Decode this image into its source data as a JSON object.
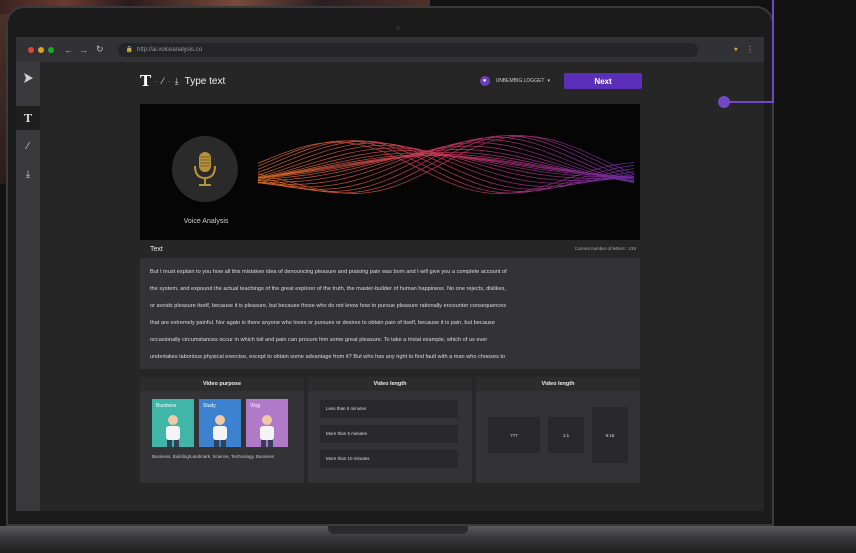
{
  "browser": {
    "url": "http://ai.voiceanalysis.co"
  },
  "sidebar": {
    "items": [
      {
        "icon": "text-icon"
      },
      {
        "icon": "magic-wand-icon"
      },
      {
        "icon": "download-icon"
      }
    ]
  },
  "toolbar": {
    "title": "Type text",
    "username": "UNBEMBIG.LOGGET",
    "next_label": "Next"
  },
  "hero": {
    "voice_label": "Voice Analysis"
  },
  "text_section": {
    "label": "Text",
    "char_count": "Current number of letters : 415",
    "lines": [
      "But I must explain to you how all this mistaken idea of denouncing pleasure and praising pain was born and I will give you a complete account of",
      "the system, and expound the actual teachings of the great explorer of the truth, the master-builder of human happiness. No one rejects, dislikes,",
      "or avoids pleasure itself, because it is pleasure, but because those who do not know how to pursue pleasure rationally encounter consequences",
      "that are extremely painful. Nor again is there anyone who loves or pursues or desires to obtain pain of itself, because it is pain, but because",
      "occasionally circumstances occur in which toil and pain can procure him some great pleasure. To take a trivial example, which of us ever",
      "undertakes laborious physical exercise, except to obtain some advantage from it? But who has any right to find fault with a man who chooses to"
    ]
  },
  "panels": {
    "purpose": {
      "title": "Video purpose",
      "cards": [
        {
          "label": "Business",
          "color": "#3fb6a8"
        },
        {
          "label": "Study",
          "color": "#3c82d1"
        },
        {
          "label": "Vlog",
          "color": "#b07ac9"
        }
      ],
      "description": "Business, Building/Landmark, Science, Technology, Business"
    },
    "length": {
      "title": "Video length",
      "options": [
        "Less than 5 minutes",
        "More than 5 minutes",
        "More than 10 minutes"
      ]
    },
    "ratio": {
      "title": "Video length",
      "options": [
        "777",
        "1:1",
        "9:16"
      ]
    }
  },
  "colors": {
    "accent": "#5b2fb8",
    "wave_start": "#f07a2a",
    "wave_mid": "#e33b6b",
    "wave_end": "#7a2fb8"
  }
}
